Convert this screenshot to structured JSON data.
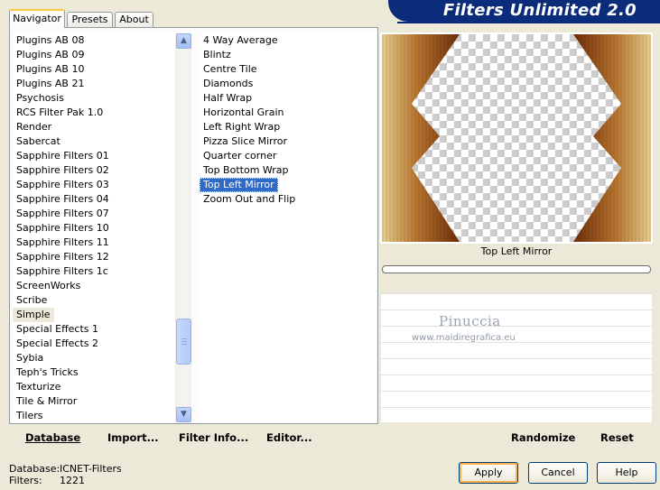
{
  "tabs": [
    "Navigator",
    "Presets",
    "About"
  ],
  "app_title": "Filters Unlimited 2.0",
  "categories": [
    "Plugins AB 08",
    "Plugins AB 09",
    "Plugins AB 10",
    "Plugins AB 21",
    "Psychosis",
    "RCS Filter Pak 1.0",
    "Render",
    "Sabercat",
    "Sapphire Filters 01",
    "Sapphire Filters 02",
    "Sapphire Filters 03",
    "Sapphire Filters 04",
    "Sapphire Filters 07",
    "Sapphire Filters 10",
    "Sapphire Filters 11",
    "Sapphire Filters 12",
    "Sapphire Filters 1c",
    "ScreenWorks",
    "Scribe",
    "Simple",
    "Special Effects 1",
    "Special Effects 2",
    "Sybia",
    "Teph's Tricks",
    "Texturize",
    "Tile & Mirror",
    "Tilers"
  ],
  "selected_category": "Simple",
  "filters": [
    "4 Way Average",
    "Blintz",
    "Centre Tile",
    "Diamonds",
    "Half Wrap",
    "Horizontal Grain",
    "Left Right Wrap",
    "Pizza Slice Mirror",
    "Quarter corner",
    "Top Bottom Wrap",
    "Top Left Mirror",
    "Zoom Out and Flip"
  ],
  "selected_filter": "Top Left Mirror",
  "preview_caption": "Top Left Mirror",
  "watermark": {
    "name": "Pinuccia",
    "url": "www.maidiregrafica.eu"
  },
  "toolbar": {
    "database": "Database",
    "import": "Import...",
    "filter_info": "Filter Info...",
    "editor": "Editor...",
    "randomize": "Randomize",
    "reset": "Reset"
  },
  "status": {
    "database_label": "Database:",
    "database_value": "ICNET-Filters",
    "filters_label": "Filters:",
    "filters_value": "1221"
  },
  "buttons": {
    "apply": "Apply",
    "cancel": "Cancel",
    "help": "Help"
  },
  "scrollbar": {
    "up_icon": "chevron-up-icon",
    "down_icon": "chevron-down-icon"
  },
  "colors": {
    "banner": "#0b2c7a",
    "selection": "#316ac5",
    "tab_accent": "#ffc83c"
  }
}
